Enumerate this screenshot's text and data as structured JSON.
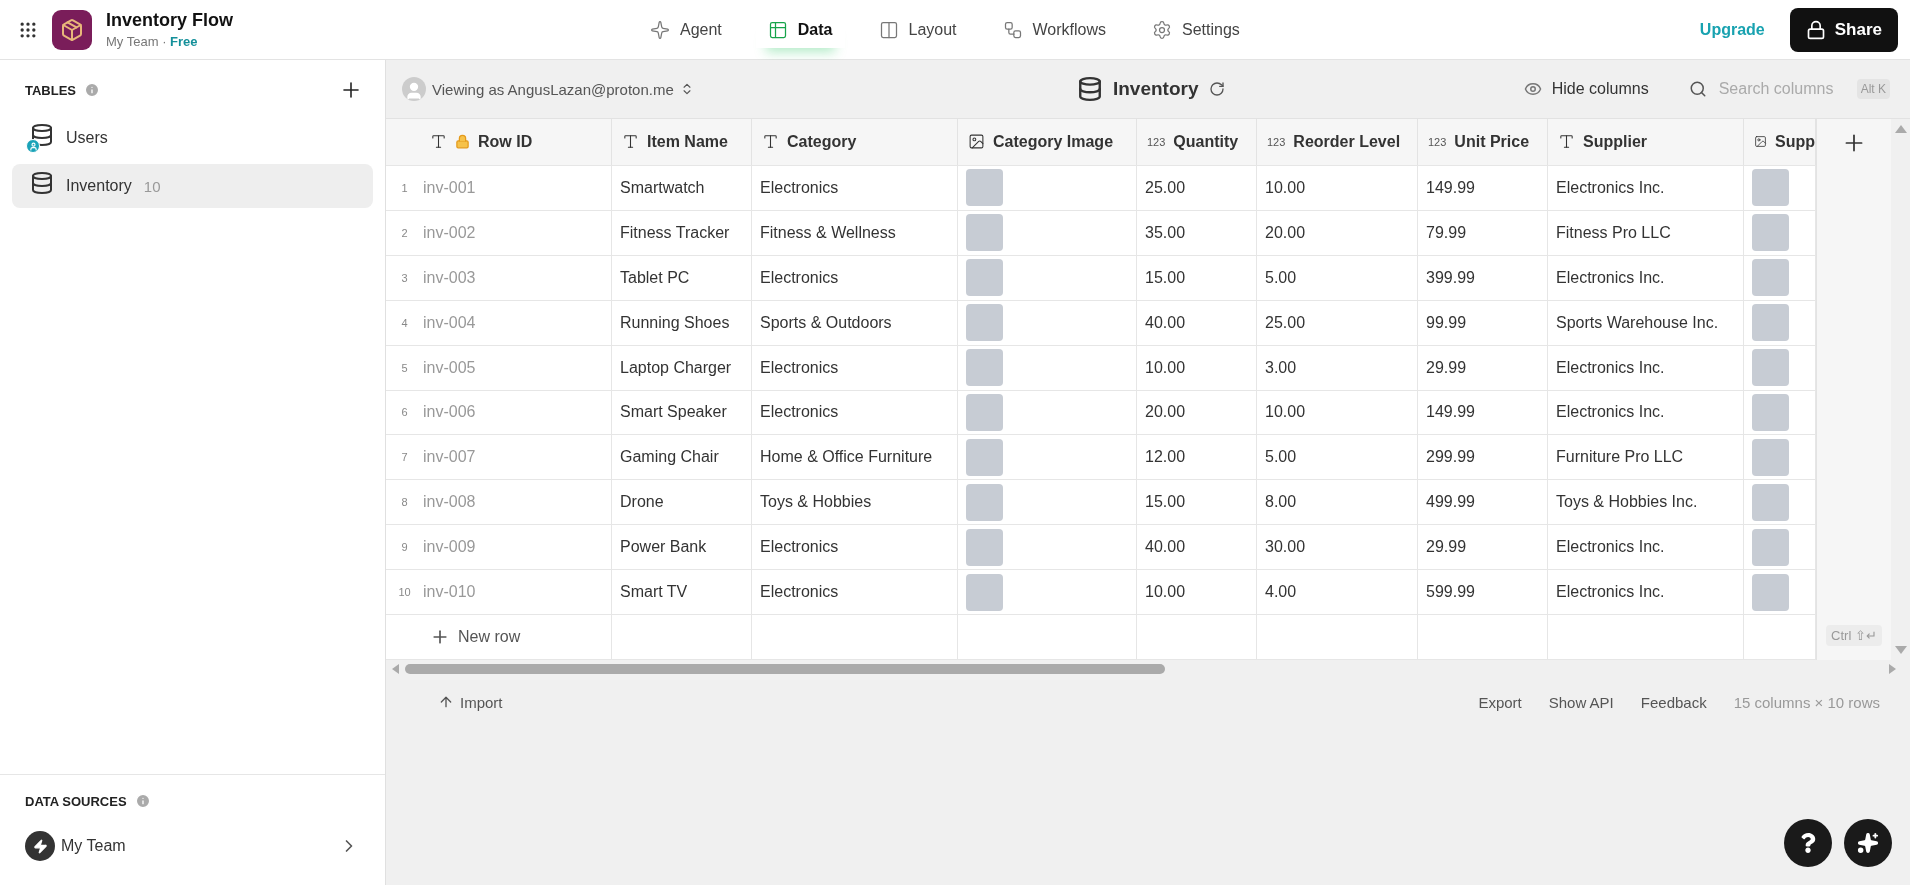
{
  "app": {
    "title": "Inventory Flow",
    "team": "My Team",
    "separator": "·",
    "plan": "Free"
  },
  "nav": [
    {
      "label": "Agent",
      "kind": "agent",
      "selected": false
    },
    {
      "label": "Data",
      "kind": "data",
      "selected": true
    },
    {
      "label": "Layout",
      "kind": "layout",
      "selected": false
    },
    {
      "label": "Workflows",
      "kind": "workflows",
      "selected": false
    },
    {
      "label": "Settings",
      "kind": "settings",
      "selected": false
    }
  ],
  "upgrade": "Upgrade",
  "share": "Share",
  "sidebar": {
    "tables_label": "TABLES",
    "items": [
      {
        "label": "Users",
        "user_badge": true,
        "selected": false
      },
      {
        "label": "Inventory",
        "count": "10",
        "user_badge": false,
        "selected": true
      }
    ],
    "sources_label": "DATA SOURCES",
    "source": "My Team"
  },
  "toolbar": {
    "viewing": "Viewing as AngusLazan@proton.me",
    "table": "Inventory",
    "hide_columns": "Hide columns",
    "search_placeholder": "Search columns",
    "search_key": "Alt K"
  },
  "table": {
    "columns": [
      {
        "label": "Row ID",
        "kind": "text",
        "locked": true
      },
      {
        "label": "Item Name",
        "kind": "text",
        "locked": false
      },
      {
        "label": "Category",
        "kind": "text",
        "locked": false
      },
      {
        "label": "Category Image",
        "kind": "image",
        "locked": false
      },
      {
        "label": "Quantity",
        "kind": "number",
        "type_label": "123",
        "locked": false
      },
      {
        "label": "Reorder Level",
        "kind": "number",
        "type_label": "123",
        "locked": false
      },
      {
        "label": "Unit Price",
        "kind": "number",
        "type_label": "123",
        "locked": false
      },
      {
        "label": "Supplier",
        "kind": "text",
        "locked": false
      },
      {
        "label": "Supp",
        "kind": "image",
        "locked": false
      }
    ],
    "rows": [
      {
        "number": "1",
        "cells": [
          "inv-001",
          "Smartwatch",
          "Electronics",
          true,
          "25.00",
          "10.00",
          "149.99",
          "Electronics Inc.",
          true
        ]
      },
      {
        "number": "2",
        "cells": [
          "inv-002",
          "Fitness Tracker",
          "Fitness & Wellness",
          true,
          "35.00",
          "20.00",
          "79.99",
          "Fitness Pro LLC",
          true
        ]
      },
      {
        "number": "3",
        "cells": [
          "inv-003",
          "Tablet PC",
          "Electronics",
          true,
          "15.00",
          "5.00",
          "399.99",
          "Electronics Inc.",
          true
        ]
      },
      {
        "number": "4",
        "cells": [
          "inv-004",
          "Running Shoes",
          "Sports & Outdoors",
          true,
          "40.00",
          "25.00",
          "99.99",
          "Sports Warehouse Inc.",
          true
        ]
      },
      {
        "number": "5",
        "cells": [
          "inv-005",
          "Laptop Charger",
          "Electronics",
          true,
          "10.00",
          "3.00",
          "29.99",
          "Electronics Inc.",
          true
        ]
      },
      {
        "number": "6",
        "cells": [
          "inv-006",
          "Smart Speaker",
          "Electronics",
          true,
          "20.00",
          "10.00",
          "149.99",
          "Electronics Inc.",
          true
        ]
      },
      {
        "number": "7",
        "cells": [
          "inv-007",
          "Gaming Chair",
          "Home & Office Furniture",
          true,
          "12.00",
          "5.00",
          "299.99",
          "Furniture Pro LLC",
          true
        ]
      },
      {
        "number": "8",
        "cells": [
          "inv-008",
          "Drone",
          "Toys & Hobbies",
          true,
          "15.00",
          "8.00",
          "499.99",
          "Toys & Hobbies Inc.",
          true
        ]
      },
      {
        "number": "9",
        "cells": [
          "inv-009",
          "Power Bank",
          "Electronics",
          true,
          "40.00",
          "30.00",
          "29.99",
          "Electronics Inc.",
          true
        ]
      },
      {
        "number": "10",
        "cells": [
          "inv-010",
          "Smart TV",
          "Electronics",
          true,
          "10.00",
          "4.00",
          "599.99",
          "Electronics Inc.",
          true
        ]
      }
    ],
    "new_row": "New row",
    "shortcut": "Ctrl ⇧↵"
  },
  "footer": {
    "import": "Import",
    "links": [
      "Export",
      "Show API",
      "Feedback"
    ],
    "summary": "15 columns × 10 rows"
  }
}
